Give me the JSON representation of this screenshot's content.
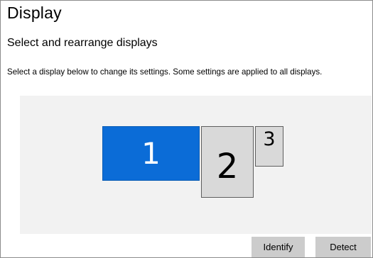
{
  "page": {
    "title": "Display",
    "subtitle": "Select and rearrange displays",
    "description": "Select a display below to change its settings. Some settings are applied to all displays."
  },
  "displays": [
    {
      "label": "1",
      "selected": true,
      "color": "#0b6cd7"
    },
    {
      "label": "2",
      "selected": false,
      "color": "#d9d9d9"
    },
    {
      "label": "3",
      "selected": false,
      "color": "#d9d9d9"
    }
  ],
  "buttons": {
    "identify_label": "Identify",
    "detect_label": "Detect"
  },
  "colors": {
    "accent": "#0b6cd7",
    "arrange_background": "#f2f2f2",
    "button_background": "#cccccc"
  }
}
